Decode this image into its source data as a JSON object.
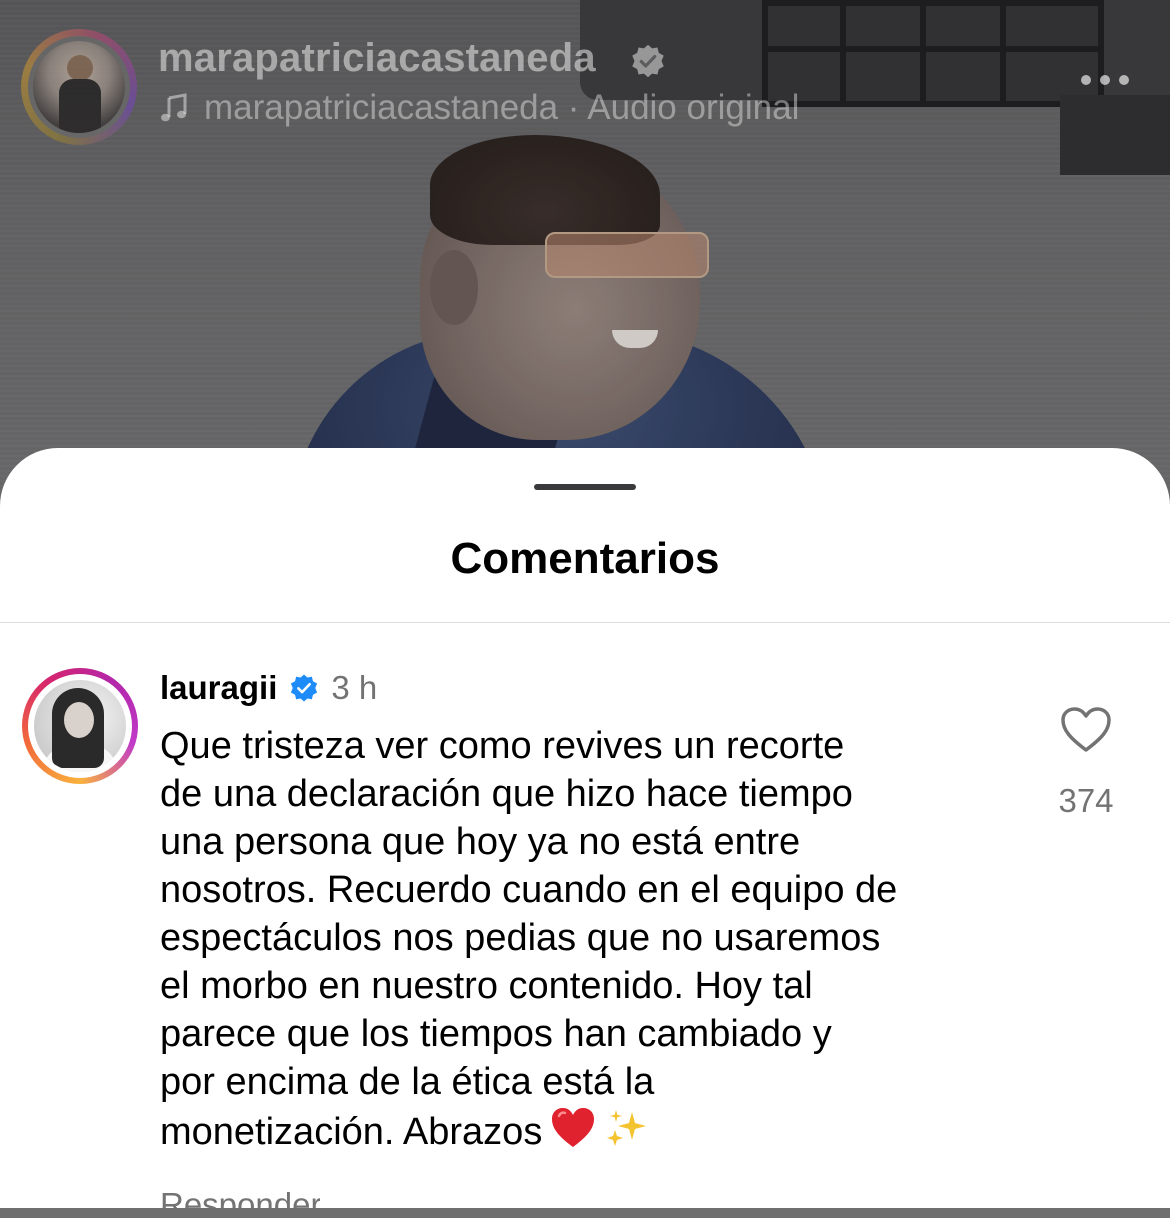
{
  "reel": {
    "username": "marapatriciacastaneda",
    "audio_label": "marapatriciacastaneda · Audio original",
    "icons": {
      "verified": "verified-badge-icon",
      "music": "music-note-icon",
      "more": "more-horizontal-icon"
    }
  },
  "sheet": {
    "title": "Comentarios"
  },
  "comment": {
    "username": "lauragii",
    "time": "3 h",
    "lines": [
      "Que tristeza ver como revives un recorte",
      "de una declaración que hizo hace tiempo",
      "una persona que hoy ya no está entre",
      "nosotros. Recuerdo cuando en el equipo de",
      "espectáculos nos pedias que no usaremos",
      "el morbo en nuestro contenido. Hoy tal",
      "parece que los tiempos han cambiado y",
      "por encima de la ética está la",
      "monetización. Abrazos"
    ],
    "emojis": [
      "❤️",
      "✨"
    ],
    "like_count": "374",
    "next_peek": "Responder"
  },
  "colors": {
    "verified_blue": "#1d8cf8",
    "secondary_text": "#737373",
    "primary_text": "#000000"
  }
}
